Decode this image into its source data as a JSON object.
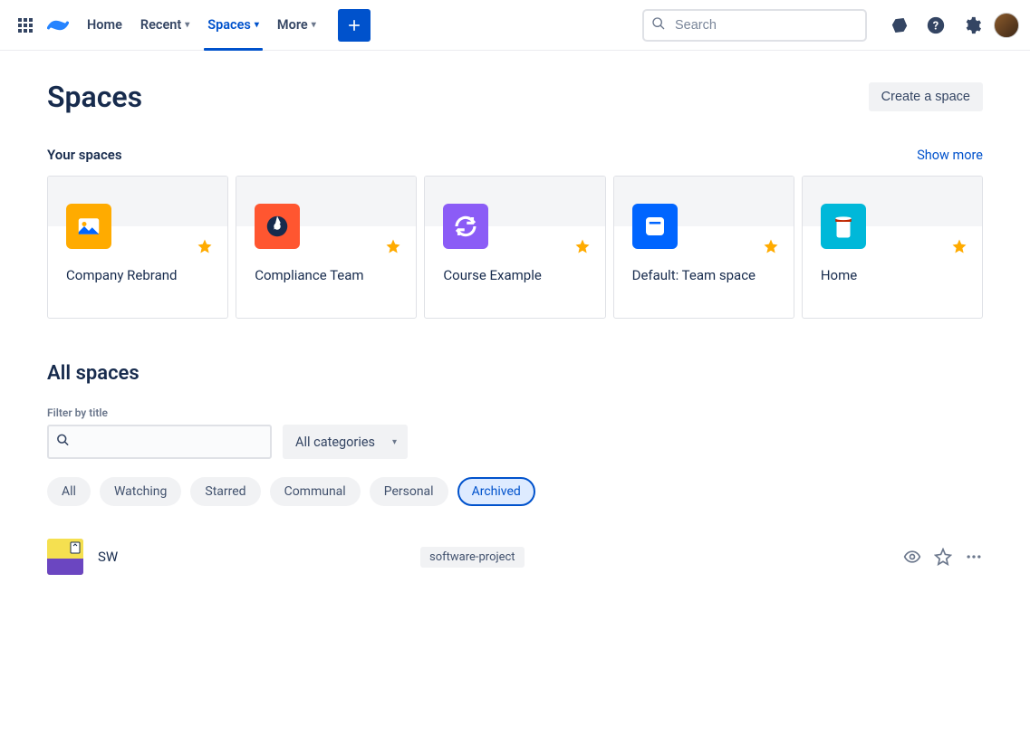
{
  "nav": {
    "home": "Home",
    "recent": "Recent",
    "spaces": "Spaces",
    "more": "More",
    "search_placeholder": "Search"
  },
  "page": {
    "title": "Spaces",
    "create_button": "Create a space"
  },
  "your_spaces": {
    "title": "Your spaces",
    "show_more": "Show more",
    "cards": [
      {
        "name": "Company Rebrand",
        "icon_bg": "#ffab00",
        "starred": true
      },
      {
        "name": "Compliance Team",
        "icon_bg": "#ff5630",
        "starred": true
      },
      {
        "name": "Course Example",
        "icon_bg": "#8b5cf6",
        "starred": true
      },
      {
        "name": "Default: Team space",
        "icon_bg": "#0065ff",
        "starred": true
      },
      {
        "name": "Home",
        "icon_bg": "#00b8d9",
        "starred": true
      }
    ]
  },
  "all_spaces": {
    "title": "All spaces",
    "filter_label": "Filter by title",
    "category_label": "All categories",
    "pills": [
      "All",
      "Watching",
      "Starred",
      "Communal",
      "Personal",
      "Archived"
    ],
    "active_pill": "Archived",
    "rows": [
      {
        "name": "SW",
        "tag": "software-project"
      }
    ]
  }
}
